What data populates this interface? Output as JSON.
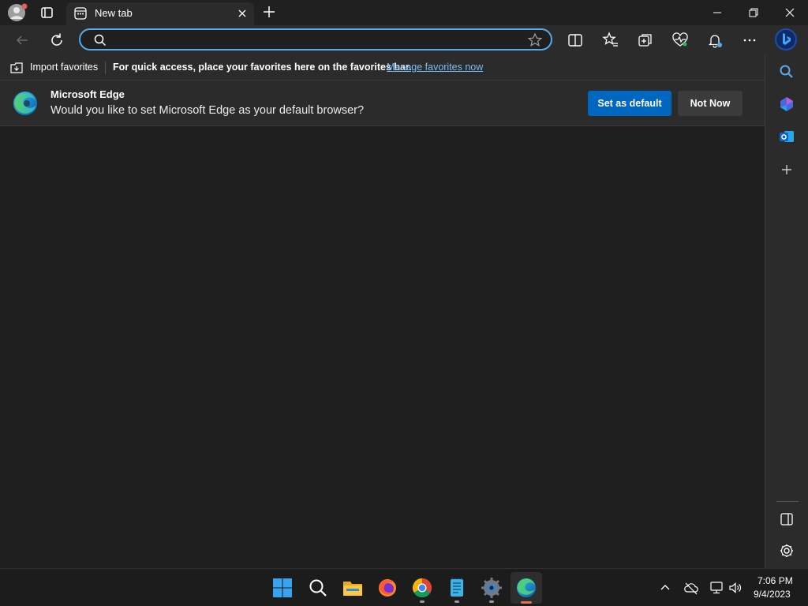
{
  "tab": {
    "title": "New tab"
  },
  "address": {
    "value": "",
    "placeholder": ""
  },
  "favorites_bar": {
    "import_label": "Import favorites",
    "message": "For quick access, place your favorites here on the favorites bar.",
    "manage_link": "Manage favorites now"
  },
  "banner": {
    "title": "Microsoft Edge",
    "message": "Would you like to set Microsoft Edge as your default browser?",
    "primary_label": "Set as default",
    "secondary_label": "Not Now"
  },
  "taskbar": {
    "apps": [
      "start-icon",
      "search-icon",
      "file-explorer-icon",
      "firefox-icon",
      "chrome-icon",
      "notepad-icon",
      "settings-icon",
      "edge-icon"
    ],
    "time": "7:06 PM",
    "date": "9/4/2023"
  },
  "colors": {
    "accent": "#0067c0",
    "focus_ring": "#5aa8e8",
    "link": "#7bbcf5"
  }
}
